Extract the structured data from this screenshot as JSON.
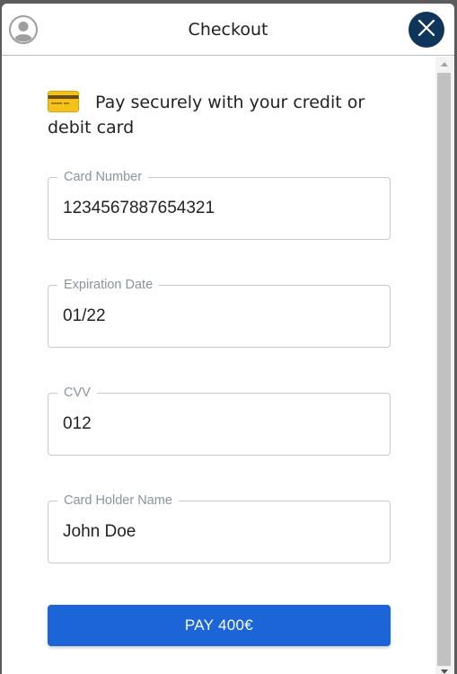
{
  "header": {
    "title": "Checkout",
    "avatar_icon": "user-avatar-icon",
    "close_icon": "close-icon",
    "close_color": "#10355a"
  },
  "intro": {
    "icon": "credit-card-icon",
    "text": "Pay securely with your credit or debit card"
  },
  "form": {
    "card_number": {
      "label": "Card Number",
      "value": "1234567887654321"
    },
    "expiration_date": {
      "label": "Expiration Date",
      "value": "01/22"
    },
    "cvv": {
      "label": "CVV",
      "value": "012"
    },
    "card_holder_name": {
      "label": "Card Holder Name",
      "value": "John Doe"
    }
  },
  "pay_button": {
    "label": "PAY 400€",
    "color": "#1b65d8"
  }
}
